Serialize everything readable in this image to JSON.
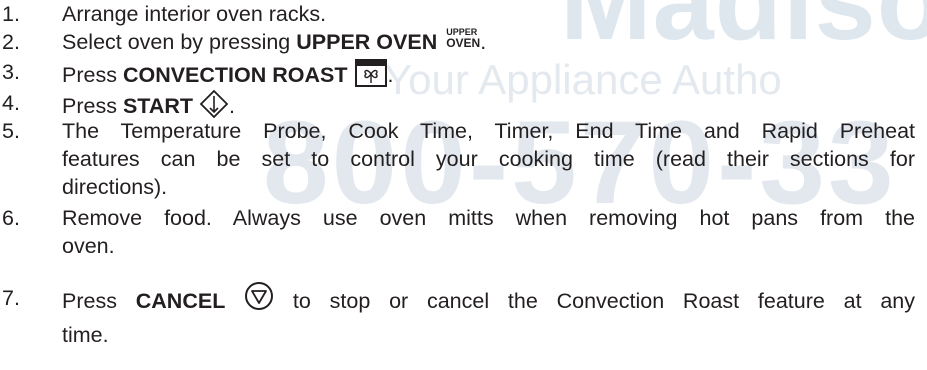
{
  "watermark": {
    "brand": "Madiso",
    "tagline": "Your Appliance Autho",
    "phone": "800-570-33"
  },
  "steps": [
    {
      "num": "1.",
      "text": "Arrange interior oven racks."
    },
    {
      "num": "2.",
      "pre": "Select oven by pressing ",
      "bold": "UPPER OVEN",
      "button_top": "UPPER",
      "button_bottom": "OVEN",
      "post": "."
    },
    {
      "num": "3.",
      "pre": "Press ",
      "bold": "CONVECTION ROAST",
      "icon": "convection-fan-icon",
      "post": "."
    },
    {
      "num": "4.",
      "pre": "Press ",
      "bold": "START",
      "icon": "start-diamond-icon",
      "post": "."
    },
    {
      "num": "5.",
      "lines": [
        "The Temperature Probe, Cook Time, Timer, End Time and Rapid Preheat",
        "features can be set to control your cooking time (read their sections for",
        "directions)."
      ]
    },
    {
      "num": "6.",
      "lines": [
        "Remove food. Always use oven mitts when removing hot pans from the",
        "oven."
      ]
    },
    {
      "num": "7.",
      "pre": "Press ",
      "bold": "CANCEL",
      "icon": "cancel-triangle-icon",
      "lines": [
        " to stop or cancel the Convection Roast feature at any",
        "time."
      ]
    }
  ]
}
